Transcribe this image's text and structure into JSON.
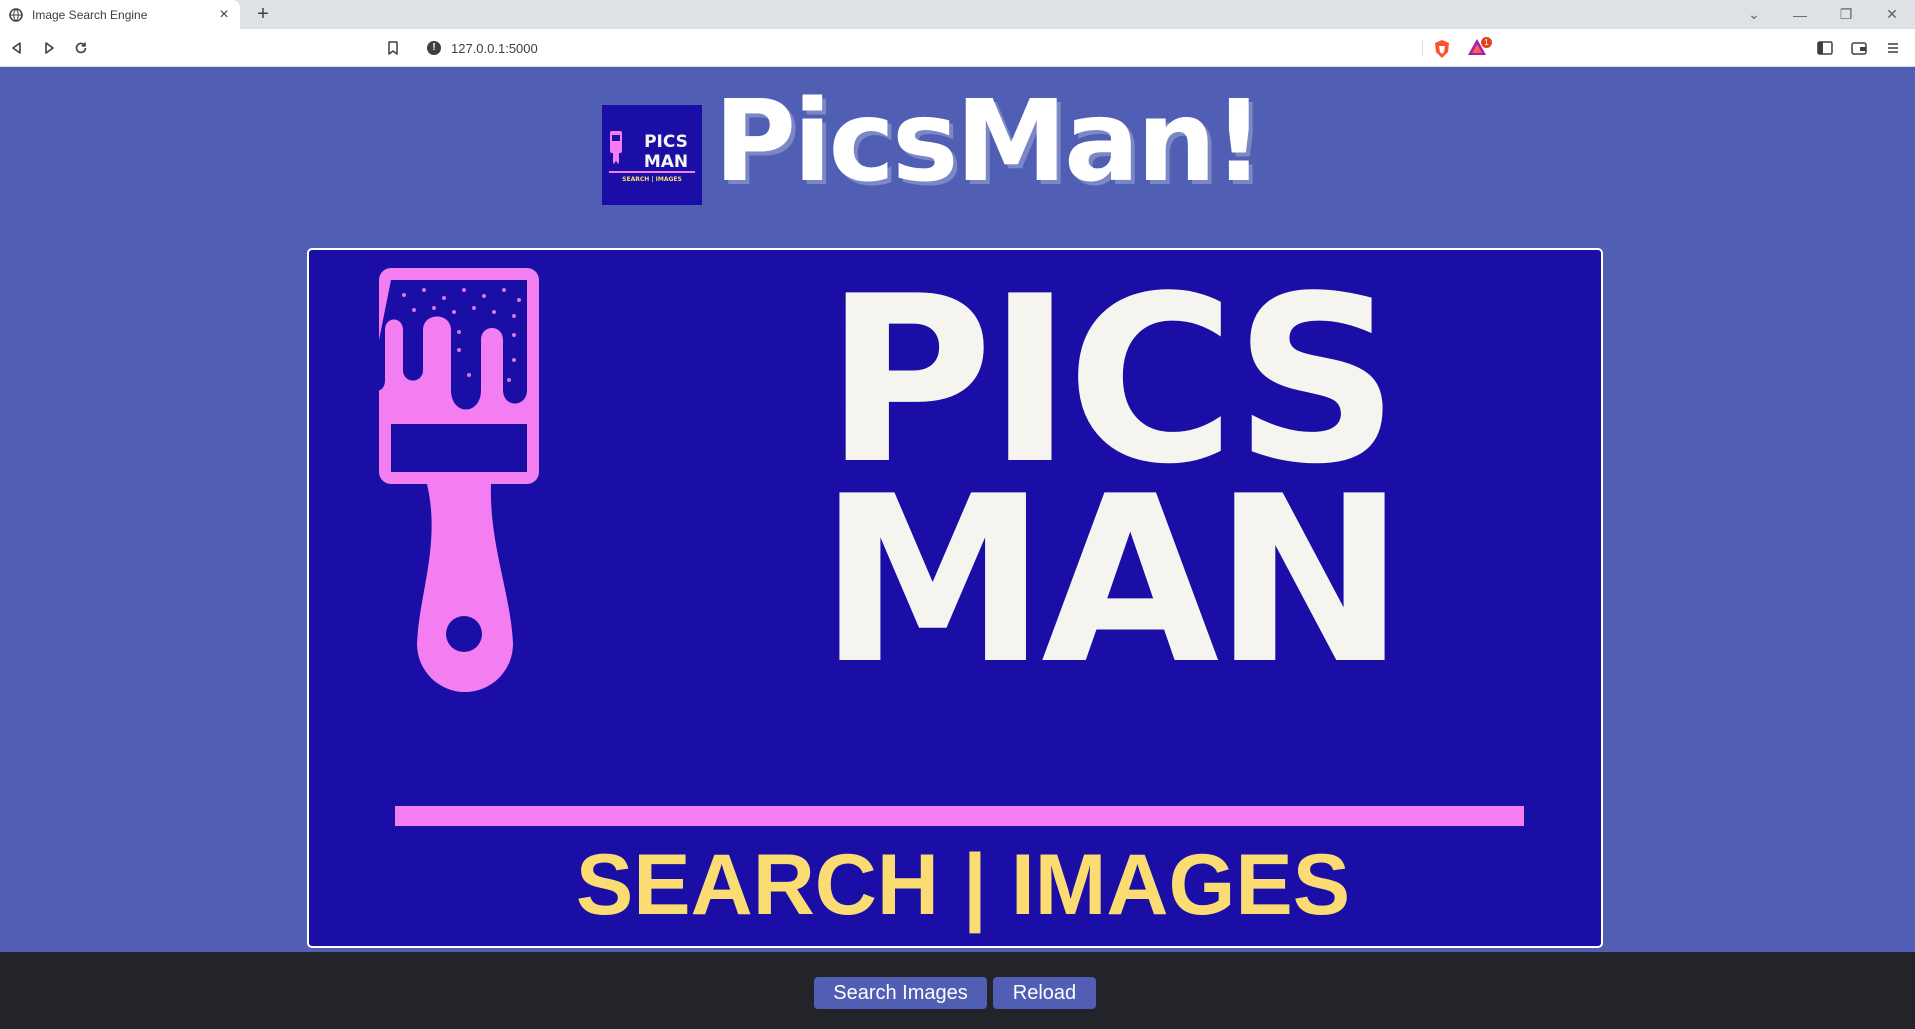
{
  "browser": {
    "tab_title": "Image Search Engine",
    "tab_close": "×",
    "new_tab": "+",
    "url": "127.0.0.1:5000",
    "info_icon_glyph": "!",
    "rewards_badge": "1",
    "icons": {
      "favicon": "globe-icon",
      "back": "back-icon",
      "forward": "forward-icon",
      "reload": "reload-icon",
      "bookmark": "bookmark-icon",
      "shield": "brave-shield-icon",
      "rewards": "brave-rewards-icon",
      "sidebar": "sidebar-icon",
      "wallet": "wallet-icon",
      "menu": "menu-icon"
    },
    "window_controls": [
      "⌄",
      "—",
      "❐",
      "✕"
    ]
  },
  "page": {
    "brand_title": "PicsMan!",
    "logo": {
      "line1": "PICS",
      "line2": "MAN",
      "tagline": "SEARCH | IMAGES"
    },
    "hero": {
      "line1": "PICS",
      "line2": "MAN",
      "tagline": "SEARCH | IMAGES"
    },
    "buttons": {
      "search": "Search Images",
      "reload": "Reload"
    }
  },
  "colors": {
    "page_bg": "#505fb3",
    "logo_bg": "#1a0ea6",
    "brush_pink": "#f27ef2",
    "logo_text": "#f6f4ee",
    "tagline_yellow": "#fadc72",
    "footer_bg": "#222429",
    "button_bg": "#505fb3"
  }
}
